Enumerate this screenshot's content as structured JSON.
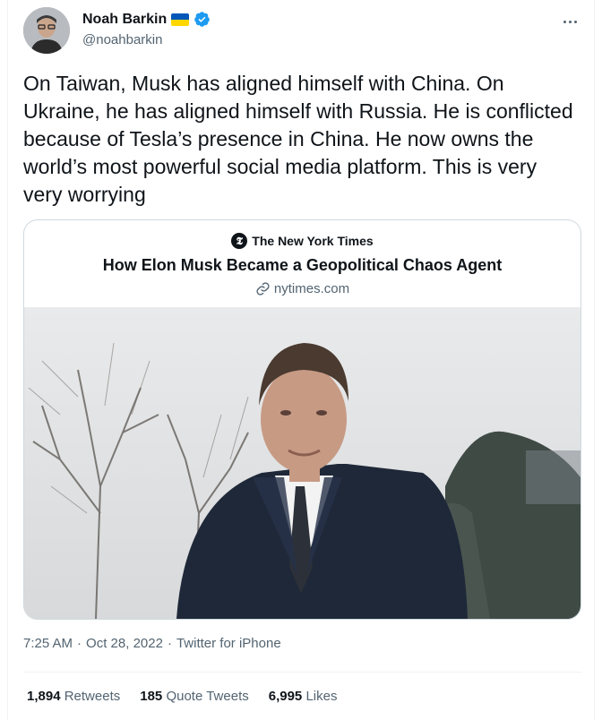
{
  "author": {
    "name": "Noah Barkin",
    "handle": "@noahbarkin"
  },
  "tweet": {
    "text": "On Taiwan, Musk has aligned himself with China. On Ukraine, he has aligned himself with Russia. He is conflicted because of Tesla’s presence in China. He now owns the world’s most powerful social media platform. This is very very worrying"
  },
  "card": {
    "source": "The New York Times",
    "source_logo_glyph": "𝕿",
    "title": "How Elon Musk Became a Geopolitical Chaos Agent",
    "domain": "nytimes.com"
  },
  "meta": {
    "time": "7:25 AM",
    "separator1": "·",
    "date": "Oct 28, 2022",
    "separator2": "·",
    "client": "Twitter for iPhone"
  },
  "stats": {
    "retweets_count": "1,894",
    "retweets_label": "Retweets",
    "quotes_count": "185",
    "quotes_label": "Quote Tweets",
    "likes_count": "6,995",
    "likes_label": "Likes"
  },
  "colors": {
    "verified": "#1d9bf0",
    "flag_blue": "#0057b7",
    "flag_yellow": "#ffd700",
    "secondary_text": "#536471"
  },
  "icons": {
    "verified": "verified-badge-icon",
    "flag": "ukraine-flag-icon",
    "more": "more-options-icon",
    "link": "link-icon"
  }
}
